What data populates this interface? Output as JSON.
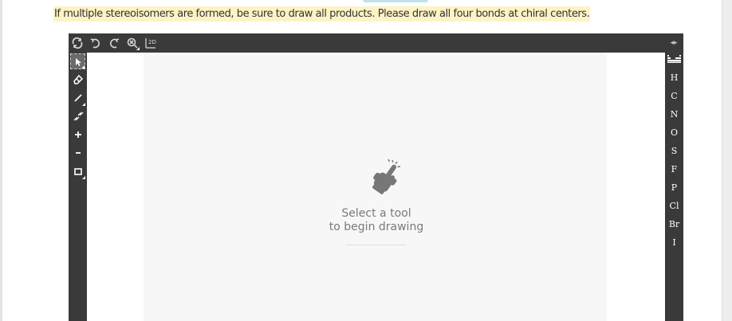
{
  "question": {
    "instruction": "If multiple stereoisomers are formed, be sure to draw all products. Please draw all four bonds at chiral centers."
  },
  "editor": {
    "top_toolbar": [
      {
        "name": "reset-icon"
      },
      {
        "name": "undo-icon"
      },
      {
        "name": "redo-icon"
      },
      {
        "name": "zoom-icon"
      },
      {
        "name": "clean-2d-icon"
      }
    ],
    "left_toolbar": [
      {
        "name": "select-icon",
        "active": true
      },
      {
        "name": "eraser-icon"
      },
      {
        "name": "bond-icon"
      },
      {
        "name": "chain-icon"
      },
      {
        "name": "charge-plus-icon"
      },
      {
        "name": "charge-minus-icon"
      },
      {
        "name": "template-icon"
      }
    ],
    "right_toolbar": {
      "periodic_table_icon": "periodic-table-icon",
      "elements": [
        "H",
        "C",
        "N",
        "O",
        "S",
        "F",
        "P",
        "Cl",
        "Br",
        "I"
      ]
    },
    "canvas": {
      "hint_line1": "Select a tool",
      "hint_line2": "to begin drawing",
      "hint_icon": "pointing-hand-icon"
    },
    "colors": {
      "toolbar_bg": "#3a3a3a",
      "highlight": "#fdf3c4",
      "canvas_bg": "#f7f7f7"
    }
  }
}
